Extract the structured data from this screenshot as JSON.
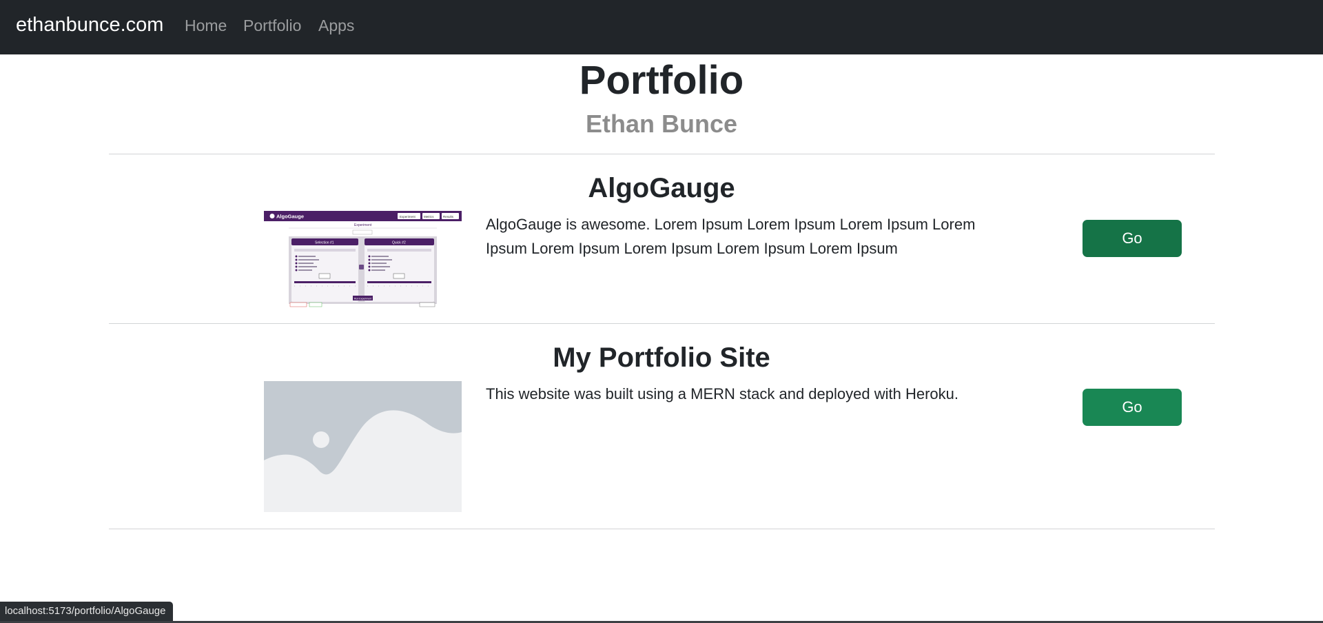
{
  "navbar": {
    "brand": "ethanbunce.com",
    "links": [
      {
        "label": "Home"
      },
      {
        "label": "Portfolio"
      },
      {
        "label": "Apps"
      }
    ]
  },
  "header": {
    "title": "Portfolio",
    "subtitle": "Ethan Bunce"
  },
  "projects": [
    {
      "title": "AlgoGauge",
      "description": "AlgoGauge is awesome. Lorem Ipsum Lorem Ipsum Lorem Ipsum Lorem Ipsum Lorem Ipsum Lorem Ipsum Lorem Ipsum Lorem Ipsum",
      "button_label": "Go",
      "thumbnail": {
        "app_name": "AlgoGauge",
        "header_buttons": [
          "Experiment",
          "Metrics",
          "Results"
        ],
        "page_heading": "Experiment",
        "panel_left_title": "Selection #1",
        "panel_right_title": "Quick #2",
        "run_button": "Run Experiment"
      }
    },
    {
      "title": "My Portfolio Site",
      "description": "This website was built using a MERN stack and deployed with Heroku.",
      "button_label": "Go",
      "thumbnail": {
        "icon": "image-placeholder-icon"
      }
    }
  ],
  "status_bar": {
    "url": "localhost:5173/portfolio/AlgoGauge"
  },
  "colors": {
    "navbar_bg": "#212529",
    "button_green": "#198754",
    "button_green_hover": "#157347",
    "subtitle_gray": "#8c8c8c",
    "thumb_purple": "#4b1f66"
  }
}
